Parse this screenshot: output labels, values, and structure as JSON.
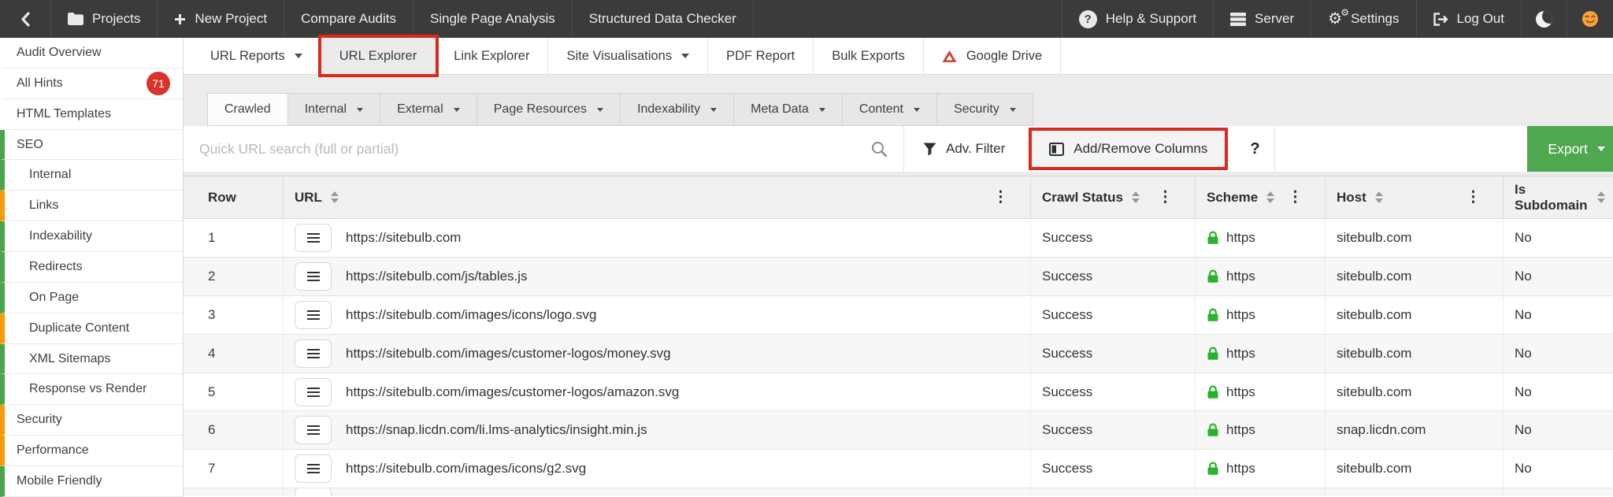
{
  "topbar": {
    "left": [
      {
        "icon": "folder-icon",
        "label": "Projects"
      },
      {
        "icon": "plus-icon",
        "label": "New Project"
      },
      {
        "label": "Compare Audits"
      },
      {
        "label": "Single Page Analysis"
      },
      {
        "label": "Structured Data Checker"
      }
    ],
    "right": [
      {
        "icon": "help-icon",
        "label": "Help & Support"
      },
      {
        "icon": "server-icon",
        "label": "Server"
      },
      {
        "icon": "gear-icon",
        "label": "Settings"
      },
      {
        "icon": "logout-icon",
        "label": "Log Out"
      }
    ]
  },
  "report_tabs": [
    {
      "label": "URL Reports",
      "dropdown": true
    },
    {
      "label": "URL Explorer",
      "active": true,
      "highlighted": true
    },
    {
      "label": "Link Explorer"
    },
    {
      "label": "Site Visualisations",
      "dropdown": true
    },
    {
      "label": "PDF Report"
    },
    {
      "label": "Bulk Exports"
    },
    {
      "label": "Google Drive",
      "icon": "google-drive-icon"
    }
  ],
  "sidebar": {
    "items": [
      {
        "label": "Audit Overview"
      },
      {
        "label": "All Hints",
        "badge": "71"
      },
      {
        "label": "HTML Templates"
      },
      {
        "label": "SEO",
        "color": "green"
      },
      {
        "label": "Internal",
        "color": "green",
        "child": true
      },
      {
        "label": "Links",
        "color": "orange",
        "child": true
      },
      {
        "label": "Indexability",
        "color": "green",
        "child": true
      },
      {
        "label": "Redirects",
        "color": "green",
        "child": true
      },
      {
        "label": "On Page",
        "color": "green",
        "child": true
      },
      {
        "label": "Duplicate Content",
        "color": "orange",
        "child": true
      },
      {
        "label": "XML Sitemaps",
        "color": "green",
        "child": true
      },
      {
        "label": "Response vs Render",
        "color": "green",
        "child": true
      },
      {
        "label": "Security",
        "color": "orange"
      },
      {
        "label": "Performance",
        "color": "orange"
      },
      {
        "label": "Mobile Friendly",
        "color": "green"
      }
    ]
  },
  "filter_tabs": [
    {
      "label": "Crawled",
      "active": true
    },
    {
      "label": "Internal",
      "dropdown": true
    },
    {
      "label": "External",
      "dropdown": true
    },
    {
      "label": "Page Resources",
      "dropdown": true
    },
    {
      "label": "Indexability",
      "dropdown": true
    },
    {
      "label": "Meta Data",
      "dropdown": true
    },
    {
      "label": "Content",
      "dropdown": true
    },
    {
      "label": "Security",
      "dropdown": true
    }
  ],
  "toolbar": {
    "search_placeholder": "Quick URL search (full or partial)",
    "adv_filter_label": "Adv. Filter",
    "add_remove_columns_label": "Add/Remove Columns",
    "help_label": "?",
    "export_label": "Export"
  },
  "table": {
    "columns": [
      {
        "label": "Row",
        "sortable": false,
        "menu": false
      },
      {
        "label": "URL",
        "sortable": true,
        "menu": true
      },
      {
        "label": "Crawl Status",
        "sortable": true,
        "menu": true
      },
      {
        "label": "Scheme",
        "sortable": true,
        "menu": true
      },
      {
        "label": "Host",
        "sortable": true,
        "menu": true
      },
      {
        "label": "Is Subdomain",
        "sortable": true,
        "menu": false
      }
    ],
    "rows": [
      {
        "row": "1",
        "url": "https://sitebulb.com",
        "crawl_status": "Success",
        "scheme": "https",
        "host": "sitebulb.com",
        "is_subdomain": "No"
      },
      {
        "row": "2",
        "url": "https://sitebulb.com/js/tables.js",
        "crawl_status": "Success",
        "scheme": "https",
        "host": "sitebulb.com",
        "is_subdomain": "No"
      },
      {
        "row": "3",
        "url": "https://sitebulb.com/images/icons/logo.svg",
        "crawl_status": "Success",
        "scheme": "https",
        "host": "sitebulb.com",
        "is_subdomain": "No"
      },
      {
        "row": "4",
        "url": "https://sitebulb.com/images/customer-logos/money.svg",
        "crawl_status": "Success",
        "scheme": "https",
        "host": "sitebulb.com",
        "is_subdomain": "No"
      },
      {
        "row": "5",
        "url": "https://sitebulb.com/images/customer-logos/amazon.svg",
        "crawl_status": "Success",
        "scheme": "https",
        "host": "sitebulb.com",
        "is_subdomain": "No"
      },
      {
        "row": "6",
        "url": "https://snap.licdn.com/li.lms-analytics/insight.min.js",
        "crawl_status": "Success",
        "scheme": "https",
        "host": "snap.licdn.com",
        "is_subdomain": "No"
      },
      {
        "row": "7",
        "url": "https://sitebulb.com/images/icons/g2.svg",
        "crawl_status": "Success",
        "scheme": "https",
        "host": "sitebulb.com",
        "is_subdomain": "No"
      }
    ]
  },
  "colors": {
    "topbar_bg": "#3b3b3b",
    "highlight_red": "#da291d",
    "badge_red": "#d8332b",
    "sidebar_green": "#4aa44a",
    "sidebar_orange": "#f79a05",
    "export_green": "#4fa74f",
    "lock_green": "#28b22e",
    "drive_red": "#cb4437"
  }
}
